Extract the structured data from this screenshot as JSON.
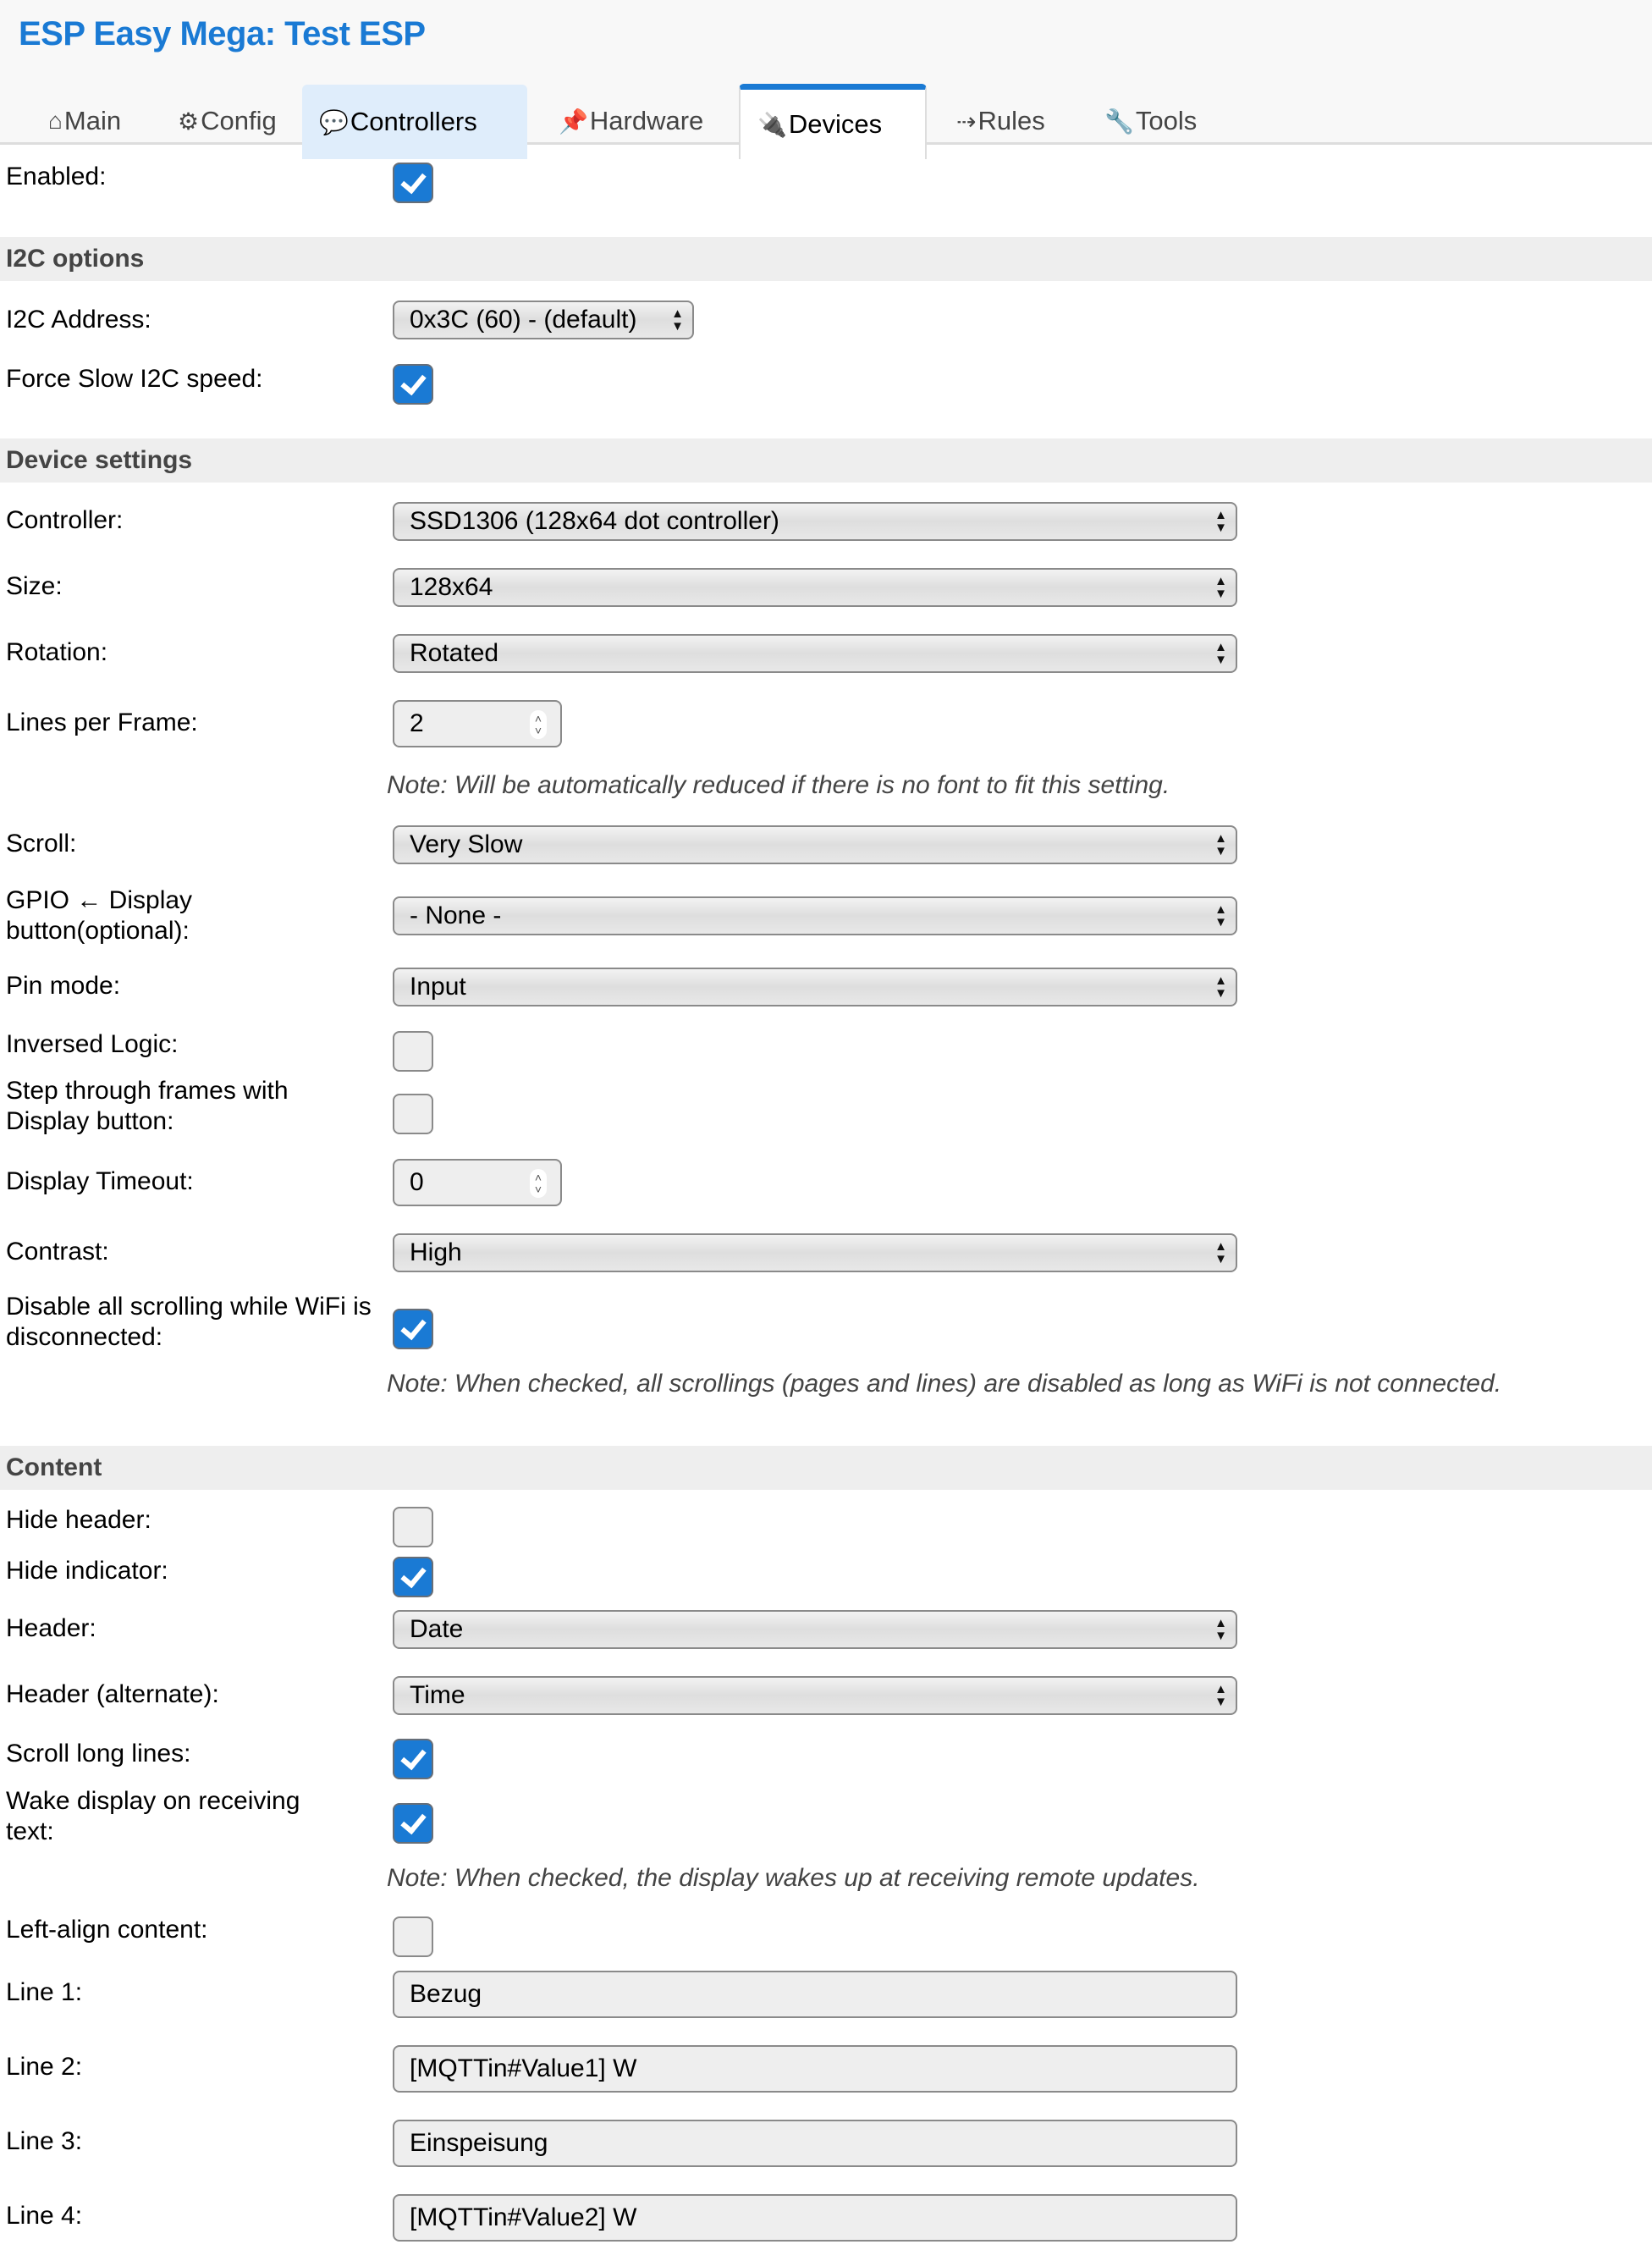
{
  "header": {
    "title": "ESP Easy Mega: Test ESP"
  },
  "tabs": [
    {
      "icon": "⌂",
      "label": "Main"
    },
    {
      "icon": "⚙",
      "label": "Config"
    },
    {
      "icon": "💬",
      "label": "Controllers"
    },
    {
      "icon": "📌",
      "label": "Hardware"
    },
    {
      "icon": "🔌",
      "label": "Devices"
    },
    {
      "icon": "⇢",
      "label": "Rules"
    },
    {
      "icon": "🔧",
      "label": "Tools"
    }
  ],
  "active_tab": "Devices",
  "top": {
    "enabled_label": "Enabled:",
    "enabled": true
  },
  "i2c": {
    "heading": "I2C options",
    "address_label": "I2C Address:",
    "address_value": "0x3C (60) - (default)",
    "slow_label": "Force Slow I2C speed:",
    "slow": true
  },
  "device": {
    "heading": "Device settings",
    "controller_label": "Controller:",
    "controller_value": "SSD1306 (128x64 dot controller)",
    "size_label": "Size:",
    "size_value": "128x64",
    "rotation_label": "Rotation:",
    "rotation_value": "Rotated",
    "lines_label": "Lines per Frame:",
    "lines_value": "2",
    "lines_note": "Note: Will be automatically reduced if there is no font to fit this setting.",
    "scroll_label": "Scroll:",
    "scroll_value": "Very Slow",
    "gpio_label": "GPIO ← Display button(optional):",
    "gpio_value": "- None -",
    "pinmode_label": "Pin mode:",
    "pinmode_value": "Input",
    "inversed_label": "Inversed Logic:",
    "inversed": false,
    "step_label": "Step through frames with Display button:",
    "step": false,
    "timeout_label": "Display Timeout:",
    "timeout_value": "0",
    "contrast_label": "Contrast:",
    "contrast_value": "High",
    "disable_scroll_label": "Disable all scrolling while WiFi is disconnected:",
    "disable_scroll": true,
    "disable_scroll_note": "Note: When checked, all scrollings (pages and lines) are disabled as long as WiFi is not connected."
  },
  "content": {
    "heading": "Content",
    "hide_header_label": "Hide header:",
    "hide_header": false,
    "hide_indicator_label": "Hide indicator:",
    "hide_indicator": true,
    "header_label": "Header:",
    "header_value": "Date",
    "header_alt_label": "Header (alternate):",
    "header_alt_value": "Time",
    "scroll_long_label": "Scroll long lines:",
    "scroll_long": true,
    "wake_label": "Wake display on receiving text:",
    "wake": true,
    "wake_note": "Note: When checked, the display wakes up at receiving remote updates.",
    "left_align_label": "Left-align content:",
    "left_align": false,
    "lines": [
      {
        "label": "Line 1:",
        "value": "Bezug"
      },
      {
        "label": "Line 2:",
        "value": "[MQTTin#Value1] W"
      },
      {
        "label": "Line 3:",
        "value": "Einspeisung"
      },
      {
        "label": "Line 4:",
        "value": "[MQTTin#Value2] W"
      }
    ]
  },
  "colors": {
    "accent": "#1a7ad4",
    "section_bg": "#eeeeee",
    "tab_hover": "#dfedfb"
  }
}
